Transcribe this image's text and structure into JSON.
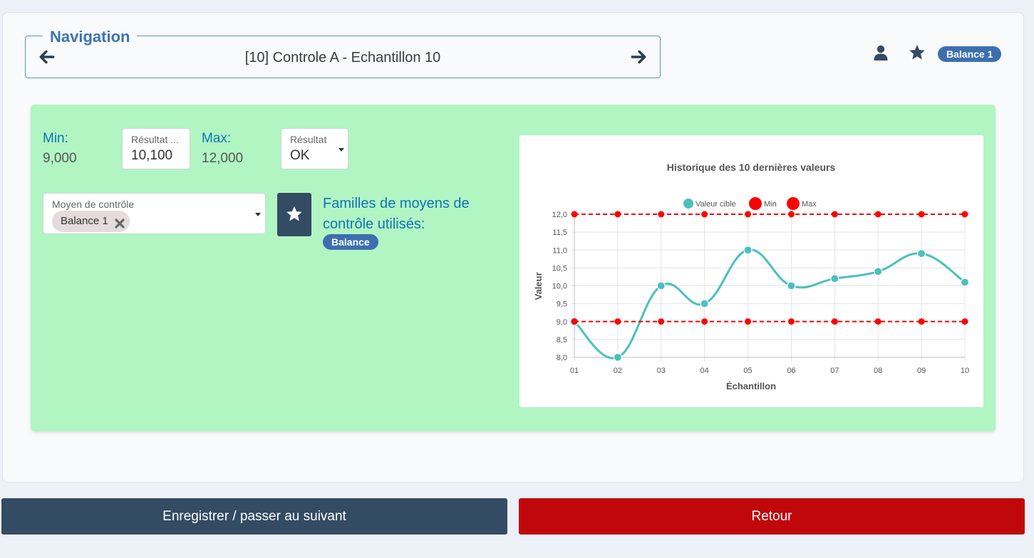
{
  "navigation": {
    "legend": "Navigation",
    "title": "[10] Controle A - Echantillon 10",
    "prev_icon": "arrow-left-icon",
    "next_icon": "arrow-right-icon"
  },
  "header": {
    "user_icon": "user-icon",
    "star_icon": "star-icon",
    "badge": "Balance 1"
  },
  "form": {
    "min_label": "Min:",
    "min_value": "9,000",
    "result_label": "Résultat ...",
    "result_value": "10,100",
    "max_label": "Max:",
    "max_value": "12,000",
    "result_select_label": "Résultat",
    "result_select_value": "OK",
    "moyen_label": "Moyen de contrôle",
    "moyen_chip": "Balance 1",
    "familles_label": "Familles de moyens de contrôle utilisés:",
    "familles_badge": "Balance"
  },
  "colors": {
    "accent_blue": "#1173b6",
    "panel_green": "#b1f5c3",
    "series_teal": "#4bbfbf",
    "limit_red": "#ff0000",
    "save_button": "#344b64",
    "back_button": "#c0080a"
  },
  "chart_data": {
    "type": "line",
    "title": "Historique des 10 dernières valeurs",
    "xlabel": "Échantillon",
    "ylabel": "Valeur",
    "categories": [
      "01",
      "02",
      "03",
      "04",
      "05",
      "06",
      "07",
      "08",
      "09",
      "10"
    ],
    "ylim": [
      8.0,
      12.0
    ],
    "yticks": [
      "8,0",
      "8,5",
      "9,0",
      "9,5",
      "10,0",
      "10,5",
      "11,0",
      "11,5",
      "12,0"
    ],
    "legend_position": "top",
    "grid": true,
    "series": [
      {
        "name": "Valeur cible",
        "values": [
          9.0,
          8.0,
          10.0,
          9.5,
          11.0,
          10.0,
          10.2,
          10.4,
          10.9,
          10.1
        ],
        "color": "#4bbfbf",
        "style": "smooth"
      },
      {
        "name": "Min",
        "values": [
          9.0,
          9.0,
          9.0,
          9.0,
          9.0,
          9.0,
          9.0,
          9.0,
          9.0,
          9.0
        ],
        "color": "#ff0000",
        "style": "dashed"
      },
      {
        "name": "Max",
        "values": [
          12.0,
          12.0,
          12.0,
          12.0,
          12.0,
          12.0,
          12.0,
          12.0,
          12.0,
          12.0
        ],
        "color": "#ff0000",
        "style": "dashed"
      }
    ]
  },
  "actions": {
    "save_label": "Enregistrer / passer au suivant",
    "back_label": "Retour"
  }
}
